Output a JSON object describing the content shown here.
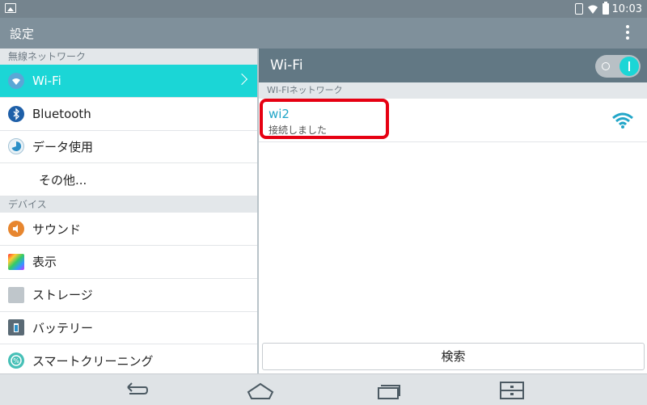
{
  "status_bar": {
    "time": "10:03"
  },
  "action_bar": {
    "title": "設定"
  },
  "left": {
    "section_wireless": "無線ネットワーク",
    "items_wireless": [
      {
        "label": "Wi-Fi",
        "icon": "wifi-icon",
        "selected": true
      },
      {
        "label": "Bluetooth",
        "icon": "bluetooth-icon"
      },
      {
        "label": "データ使用",
        "icon": "data-usage-icon"
      },
      {
        "label": "その他...",
        "icon": ""
      }
    ],
    "section_device": "デバイス",
    "items_device": [
      {
        "label": "サウンド",
        "icon": "sound-icon"
      },
      {
        "label": "表示",
        "icon": "display-icon"
      },
      {
        "label": "ストレージ",
        "icon": "storage-icon"
      },
      {
        "label": "バッテリー",
        "icon": "battery-icon"
      },
      {
        "label": "スマートクリーニング",
        "icon": "smart-cleaning-icon"
      }
    ]
  },
  "right": {
    "header_title": "Wi-Fi",
    "wifi_toggle": "on",
    "section": "WI-FIネットワーク",
    "network": {
      "name": "wi2",
      "status": "接続しました"
    },
    "search_button": "検索"
  },
  "colors": {
    "accent": "#1bd6d6",
    "highlight": "#e60012"
  }
}
